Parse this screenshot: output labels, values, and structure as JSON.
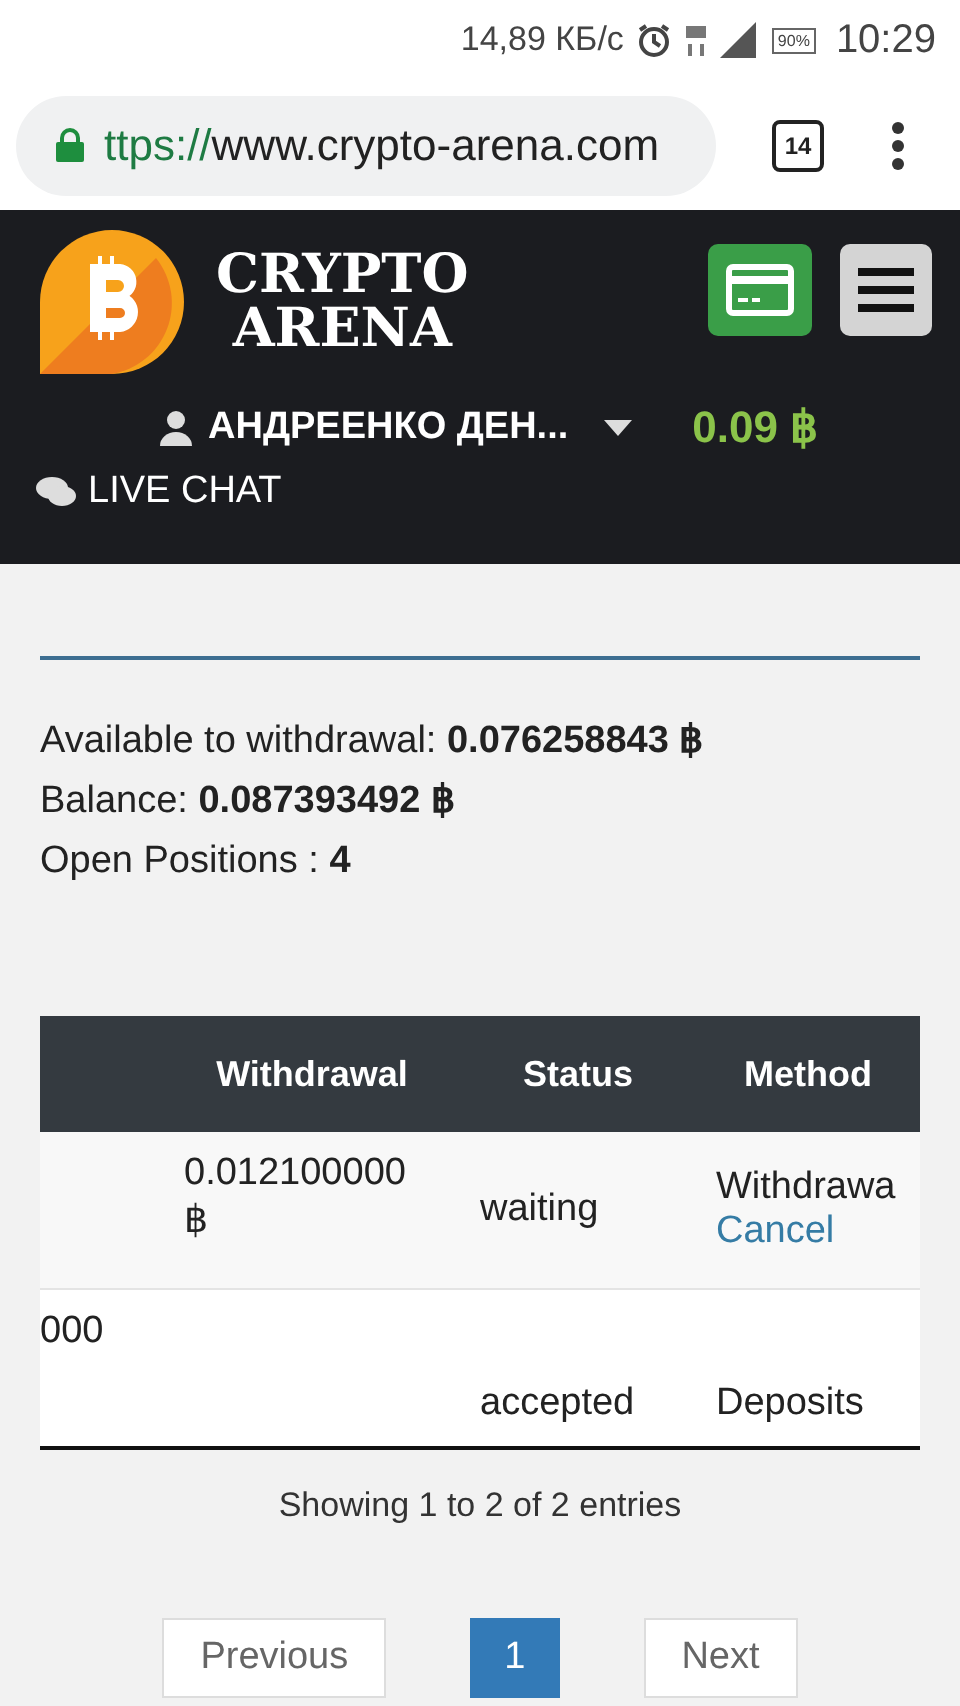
{
  "status_bar": {
    "speed": "14,89 КБ/с",
    "battery": "90%",
    "time": "10:29"
  },
  "browser": {
    "url_scheme": "ttps://",
    "url_host": "www.crypto-arena.com",
    "tab_count": "14"
  },
  "header": {
    "logo_line_1": "CRYPTO",
    "logo_line_2": "ARENA",
    "user": "АНДРЕЕНКО ДЕН...",
    "balance": "0.09 ฿",
    "live_chat": "LIVE CHAT"
  },
  "summary": [
    {
      "label": "Available to withdrawal: ",
      "value": "0.076258843 ฿"
    },
    {
      "label": "Balance: ",
      "value": "0.087393492 ฿"
    },
    {
      "label": "Open Positions : ",
      "value": "4"
    }
  ],
  "table": {
    "columns": [
      "",
      "Withdrawal",
      "Status",
      "Method"
    ],
    "rows": [
      {
        "cells": [
          "",
          "0.012100000 ฿",
          "waiting",
          "Withdrawa"
        ],
        "link": "Cancel"
      },
      {
        "cells": [
          "000",
          "",
          "accepted",
          "Deposits"
        ]
      }
    ]
  },
  "info": "Showing 1 to 2 of 2 entries",
  "pagination": [
    {
      "label": "Previous",
      "kind": "nav",
      "selected": false
    },
    {
      "label": "1",
      "kind": "page",
      "selected": true
    },
    {
      "label": "Next",
      "kind": "nav",
      "selected": false
    }
  ]
}
